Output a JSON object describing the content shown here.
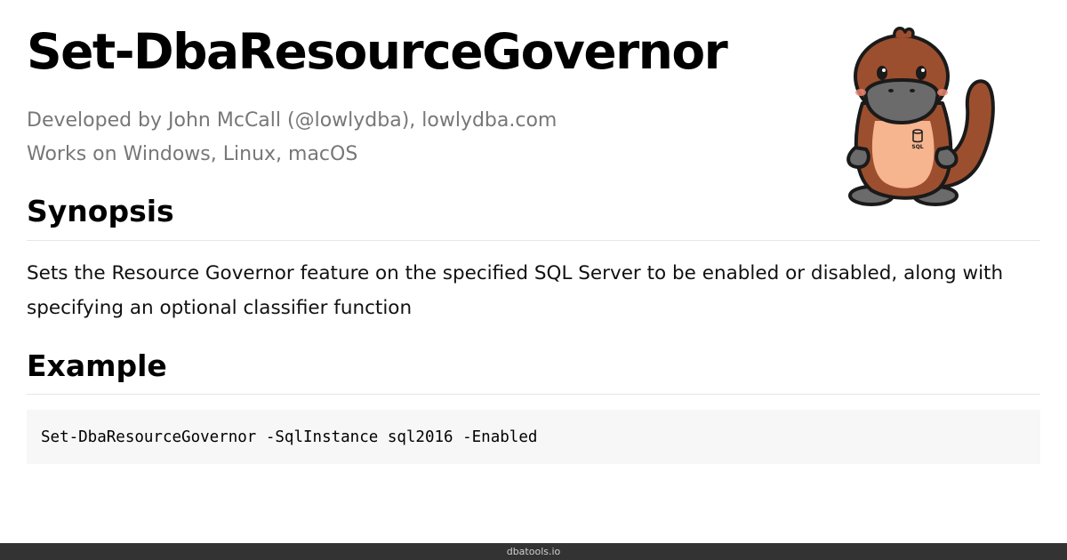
{
  "page": {
    "title": "Set-DbaResourceGovernor",
    "meta": {
      "developed_by": "Developed by John McCall (@lowlydba), lowlydba.com",
      "platforms": "Works on Windows, Linux, macOS"
    }
  },
  "synopsis": {
    "heading": "Synopsis",
    "text": "Sets the Resource Governor feature on the specified SQL Server to be enabled or disabled, along with specifying an optional classifier function"
  },
  "example": {
    "heading": "Example",
    "code": "Set-DbaResourceGovernor -SqlInstance sql2016 -Enabled"
  },
  "mascot": {
    "icon": "platypus-mascot-icon",
    "badge_text": "SQL"
  },
  "footer": {
    "text": "dbatools.io"
  },
  "colors": {
    "title": "#000000",
    "meta": "#777777",
    "code_background": "#f7f7f7",
    "footer_background": "#333333",
    "mascot_body": "#9c4f2e",
    "mascot_belly": "#f6b48f",
    "mascot_bill": "#6b6b6b"
  }
}
